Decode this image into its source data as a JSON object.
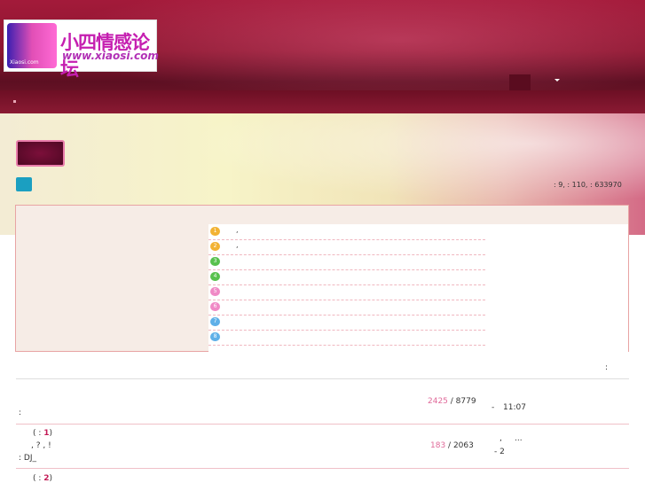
{
  "site": {
    "logo_cn": "小四情感论坛",
    "logo_url": "www.xiaosi.com",
    "logo_small": "Xiaosi.com"
  },
  "stats": {
    "text": ": 9,  : 110,  : 633970"
  },
  "panel": {
    "rows": [
      {
        "badge": "1",
        "color": "#f2b233",
        "text": ","
      },
      {
        "badge": "2",
        "color": "#f2b233",
        "text": ","
      },
      {
        "badge": "3",
        "color": "#58c14e",
        "text": ""
      },
      {
        "badge": "4",
        "color": "#58c14e",
        "text": ""
      },
      {
        "badge": "5",
        "color": "#f08ac6",
        "text": ""
      },
      {
        "badge": "6",
        "color": "#f08ac6",
        "text": ""
      },
      {
        "badge": "7",
        "color": "#5fb0e8",
        "text": ""
      },
      {
        "badge": "8",
        "color": "#5fb0e8",
        "text": ""
      }
    ]
  },
  "header_colon": ":",
  "forums": [
    {
      "colon": ":",
      "posts_pink": "2425",
      "posts_total": " / 8779",
      "last_dash": "-",
      "last_time": "11:07"
    },
    {
      "title_prefix": "( : ",
      "title_num": "1",
      "title_suffix": ")",
      "desc": ",       ?       ,        !",
      "moderator": ": DJ_",
      "posts_pink": "183",
      "posts_total": " / 2063",
      "last_comma": ",",
      "last_ellipsis": "...",
      "last_dash": "- 2"
    },
    {
      "title_prefix": "( : ",
      "title_num": "2",
      "title_suffix": ")"
    }
  ]
}
